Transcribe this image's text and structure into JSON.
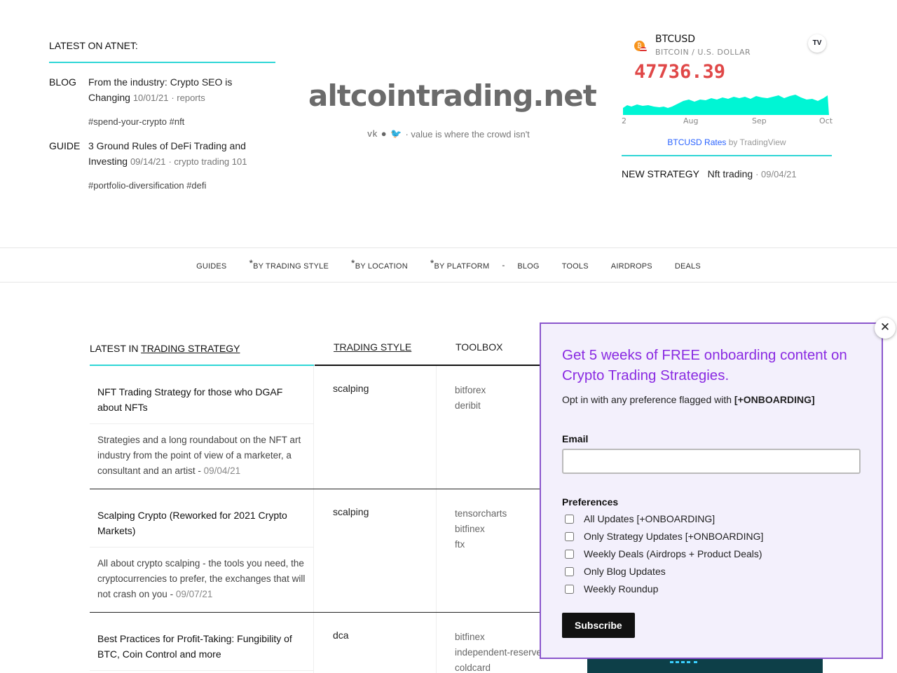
{
  "latest": {
    "title": "LATEST ON ATNET:",
    "entries": [
      {
        "kind": "BLOG",
        "title": "From the industry: Crypto SEO is Changing",
        "date": "10/01/21",
        "category": "reports",
        "tags": "#spend-your-crypto #nft"
      },
      {
        "kind": "GUIDE",
        "title": "3 Ground Rules of DeFi Trading and Investing",
        "date": "09/14/21",
        "category": "crypto trading 101",
        "tags": "#portfolio-diversification #defi"
      }
    ]
  },
  "brand": {
    "name": "altcointrading.net",
    "social_glyphs": "vk ● 🐦",
    "tagline": "· value is where the crowd isn't"
  },
  "ticker": {
    "symbol": "BTCUSD",
    "description": "BITCOIN / U.S. DOLLAR",
    "price": "47736.39",
    "coin_glyph": "₿",
    "tv_logo": "TV",
    "axis_labels": [
      "2",
      "Aug",
      "Sep",
      "Oct"
    ],
    "credit_link": "BTCUSD Rates",
    "credit_by": " by TradingView",
    "price_color": "#e04848",
    "fill_color": "#00f5d4"
  },
  "new_strategy": {
    "label": "NEW STRATEGY",
    "title": "Nft trading",
    "date": "· 09/04/21"
  },
  "nav": {
    "items": [
      {
        "label": "GUIDES",
        "star": ""
      },
      {
        "label": "BY TRADING STYLE",
        "star": "*"
      },
      {
        "label": "BY LOCATION",
        "star": "*"
      },
      {
        "label": "BY PLATFORM",
        "star": "*"
      },
      {
        "label": "-",
        "star": ""
      },
      {
        "label": "BLOG",
        "star": ""
      },
      {
        "label": "TOOLS",
        "star": ""
      },
      {
        "label": "AIRDROPS",
        "star": ""
      },
      {
        "label": "DEALS",
        "star": ""
      }
    ]
  },
  "table": {
    "head_latest_prefix": "LATEST IN ",
    "head_latest_link": "TRADING STRATEGY",
    "head_style": "TRADING STYLE",
    "head_tools": "TOOLBOX",
    "rows": [
      {
        "title": "NFT Trading Strategy for those who DGAF about NFTs",
        "desc": "Strategies and a long roundabout on the NFT art industry from the point of view of a marketer, a consultant and an artist - ",
        "date": "09/04/21",
        "style": "scalping",
        "tools": [
          "bitforex",
          "deribit"
        ]
      },
      {
        "title": "Scalping Crypto (Reworked for 2021 Crypto Markets)",
        "desc": "All about crypto scalping - the tools you need, the cryptocurrencies to prefer, the exchanges that will not crash on you - ",
        "date": "09/07/21",
        "style": "scalping",
        "tools": [
          "tensorcharts",
          "bitfinex",
          "ftx"
        ]
      },
      {
        "title": "Best Practices for Profit-Taking: Fungibility of BTC, Coin Control and more",
        "desc": "",
        "date": "",
        "style": "dca",
        "tools": [
          "bitfinex",
          "independent-reserve",
          "coldcard"
        ]
      }
    ]
  },
  "popup": {
    "close_glyph": "✕",
    "heading": "Get 5 weeks of FREE onboarding content on Crypto Trading Strategies.",
    "sub_prefix": "Opt in with any preference flagged with ",
    "sub_flag": "[+ONBOARDING]",
    "email_label": "Email",
    "email_value": "",
    "prefs_label": "Preferences",
    "prefs": [
      "All Updates [+ONBOARDING]",
      "Only Strategy Updates [+ONBOARDING]",
      "Weekly Deals (Airdrops + Product Deals)",
      "Only Blog Updates",
      "Weekly Roundup"
    ],
    "subscribe_label": "Subscribe",
    "accent_color": "#8a2be2"
  }
}
